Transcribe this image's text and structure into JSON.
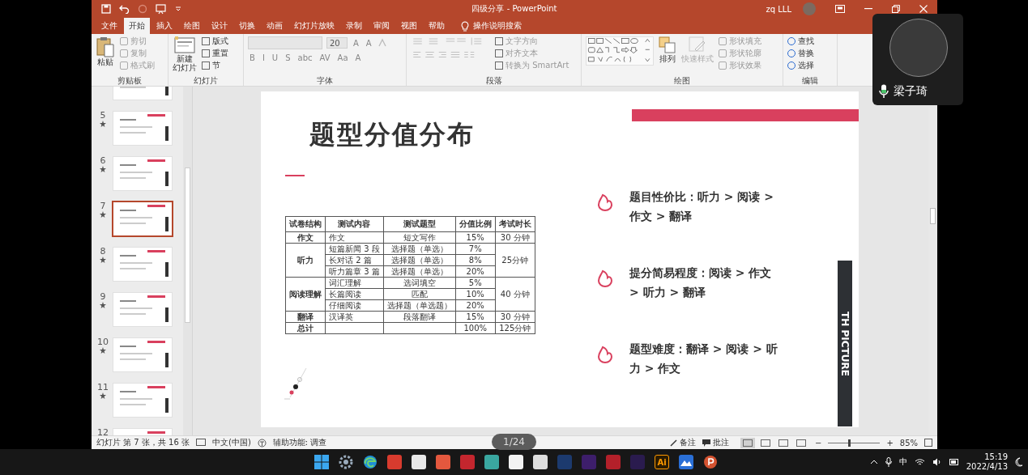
{
  "title_bar": {
    "title": "四级分享 - PowerPoint",
    "user": "zq LLL"
  },
  "tabs": [
    {
      "label": "文件",
      "selected": false
    },
    {
      "label": "开始",
      "selected": true
    },
    {
      "label": "插入",
      "selected": false
    },
    {
      "label": "绘图",
      "selected": false
    },
    {
      "label": "设计",
      "selected": false
    },
    {
      "label": "切换",
      "selected": false
    },
    {
      "label": "动画",
      "selected": false
    },
    {
      "label": "幻灯片放映",
      "selected": false
    },
    {
      "label": "录制",
      "selected": false
    },
    {
      "label": "审阅",
      "selected": false
    },
    {
      "label": "视图",
      "selected": false
    },
    {
      "label": "帮助",
      "selected": false
    }
  ],
  "tell_me": "操作说明搜索",
  "ribbon": {
    "clipboard": {
      "label": "剪贴板",
      "paste": "粘贴",
      "items": [
        {
          "label": "剪切",
          "disabled": true
        },
        {
          "label": "复制",
          "disabled": true
        },
        {
          "label": "格式刷",
          "disabled": true
        }
      ]
    },
    "slides": {
      "label": "幻灯片",
      "new_slide": [
        "新建",
        "幻灯片"
      ],
      "items": [
        {
          "label": "版式",
          "disabled": false
        },
        {
          "label": "重置",
          "disabled": false
        },
        {
          "label": "节",
          "disabled": false
        }
      ]
    },
    "font": {
      "label": "字体",
      "size": "20",
      "size_buttons": [
        "A",
        "A"
      ],
      "format_buttons": [
        "B",
        "I",
        "U",
        "S",
        "abc",
        "AV",
        "Aa",
        "A"
      ]
    },
    "paragraph": {
      "label": "段落",
      "items": [
        {
          "label": "文字方向",
          "disabled": true
        },
        {
          "label": "对齐文本",
          "disabled": true
        },
        {
          "label": "转换为 SmartArt",
          "disabled": true
        }
      ]
    },
    "drawing": {
      "label": "绘图",
      "arrange": "排列",
      "quick_styles": "快速样式",
      "items": [
        {
          "label": "形状填充",
          "disabled": true
        },
        {
          "label": "形状轮廓",
          "disabled": true
        },
        {
          "label": "形状效果",
          "disabled": true
        }
      ]
    },
    "editing": {
      "label": "编辑",
      "items": [
        {
          "label": "查找",
          "disabled": false
        },
        {
          "label": "替换",
          "disabled": false
        },
        {
          "label": "选择",
          "disabled": false
        }
      ]
    }
  },
  "thumbnails": [
    {
      "selected": false
    },
    {
      "number": "5",
      "selected": false
    },
    {
      "number": "6",
      "selected": false
    },
    {
      "number": "7",
      "selected": true
    },
    {
      "number": "8",
      "selected": false
    },
    {
      "number": "9",
      "selected": false
    },
    {
      "number": "10",
      "selected": false
    },
    {
      "number": "11",
      "selected": false
    },
    {
      "number": "12",
      "selected": false
    }
  ],
  "slide": {
    "title": "题型分值分布",
    "table": {
      "columns": [
        "试卷结构",
        "测试内容",
        "测试题型",
        "分值比例",
        "考试时长"
      ],
      "sections": [
        {
          "section": "作文",
          "duration": "30 分钟",
          "items": [
            {
              "content": "作文",
              "type": "短文写作",
              "ratio": "15%"
            }
          ]
        },
        {
          "section": "听力",
          "duration": "25分钟",
          "items": [
            {
              "content": "短篇新闻 3 段",
              "type": "选择题（单选）",
              "ratio": "7%"
            },
            {
              "content": "长对话 2 篇",
              "type": "选择题（单选）",
              "ratio": "8%"
            },
            {
              "content": "听力篇章 3 篇",
              "type": "选择题（单选）",
              "ratio": "20%"
            }
          ]
        },
        {
          "section": "阅读理解",
          "duration": "40 分钟",
          "items": [
            {
              "content": "词汇理解",
              "type": "选词填空",
              "ratio": "5%"
            },
            {
              "content": "长篇阅读",
              "type": "匹配",
              "ratio": "10%"
            },
            {
              "content": "仔细阅读",
              "type": "选择题（单选题）",
              "ratio": "20%"
            }
          ]
        },
        {
          "section": "翻译",
          "duration": "30 分钟",
          "items": [
            {
              "content": "汉译英",
              "type": "段落翻译",
              "ratio": "15%"
            }
          ]
        }
      ],
      "total": {
        "label": "总计",
        "ratio": "100%",
        "duration": "125分钟"
      }
    },
    "points": [
      "题目性价比：听力 > 阅读 > 作文 > 翻译",
      "提分简易程度：阅读 > 作文 > 听力 > 翻译",
      "题型难度：翻译 > 阅读 > 听力 > 作文"
    ],
    "side_label": "TH PICTURE"
  },
  "status_bar": {
    "slide_info": "幻灯片 第 7 张，共 16 张",
    "language": "中文(中国)",
    "accessibility": "辅助功能: 调查",
    "notes": "备注",
    "comments": "批注",
    "views": [
      {
        "selected": true
      },
      {
        "selected": false
      },
      {
        "selected": false
      },
      {
        "selected": false
      }
    ],
    "zoom_out": "−",
    "zoom_in": "+",
    "zoom_slider": {
      "level": 0.38
    },
    "zoom": "85%"
  },
  "page_counter": "1/24",
  "video_tile": {
    "name": "梁子琦"
  },
  "taskbar": {
    "apps": [
      {
        "kind": "windows"
      },
      {
        "kind": "gear"
      },
      {
        "kind": "edge"
      },
      {
        "kind": "tile",
        "color": "#d83b2e"
      },
      {
        "kind": "tile",
        "color": "#e8e8e8"
      },
      {
        "kind": "tile",
        "color": "#e4583e"
      },
      {
        "kind": "tile",
        "color": "#c4262e"
      },
      {
        "kind": "tile",
        "color": "#3aa7a0"
      },
      {
        "kind": "tile",
        "color": "#f2f2f2"
      },
      {
        "kind": "tile",
        "color": "#dddddd"
      },
      {
        "kind": "tile",
        "color": "#1c3a6e"
      },
      {
        "kind": "tile",
        "color": "#3d1e6b"
      },
      {
        "kind": "tile",
        "color": "#b3202a"
      },
      {
        "kind": "tile",
        "color": "#2a1b4e"
      },
      {
        "kind": "label",
        "color": "#2b1b00",
        "label": "Ai"
      },
      {
        "kind": "photos"
      },
      {
        "kind": "powerpoint"
      }
    ],
    "ime": "中",
    "time": "15:19",
    "date": "2022/4/13"
  }
}
